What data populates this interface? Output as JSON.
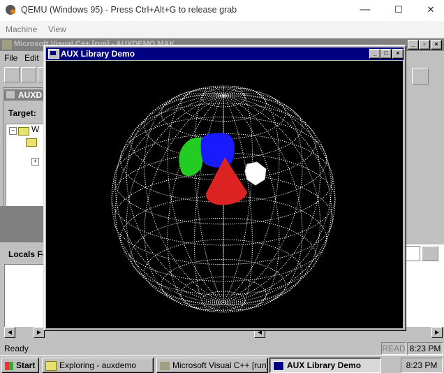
{
  "host": {
    "title": "QEMU (Windows 95) - Press Ctrl+Alt+G to release grab",
    "menu": [
      "Machine",
      "View"
    ],
    "controls": {
      "minimize": "—",
      "maximize": "☐",
      "close": "✕"
    }
  },
  "vc": {
    "title": "Microsoft Visual C++ [run] - AUXDEMO.MAK",
    "menu": [
      "File",
      "Edit"
    ],
    "workspace_title": "AUXD",
    "target_label": "Target:",
    "tree_root": "W",
    "locals_label": "Locals Fo",
    "status_ready": "Ready",
    "status_read": "READ",
    "status_time": "8:23 PM"
  },
  "aux": {
    "title": "AUX Library Demo",
    "scene": {
      "background": "#000000",
      "sphere_color": "#ffffff",
      "objects": [
        {
          "shape": "cube",
          "color": "#1a1aff"
        },
        {
          "shape": "torus",
          "color": "#22cc22"
        },
        {
          "shape": "cone",
          "color": "#dd2222"
        },
        {
          "shape": "icosahedron",
          "color": "#ffffff"
        }
      ]
    }
  },
  "taskbar": {
    "start": "Start",
    "tasks": [
      {
        "label": "Exploring - auxdemo",
        "icon": "folder-icon"
      },
      {
        "label": "Microsoft Visual C++ [run] -...",
        "icon": "visual-cpp-icon"
      },
      {
        "label": "AUX Library Demo",
        "icon": "window-icon"
      }
    ],
    "clock": "8:23 PM"
  }
}
